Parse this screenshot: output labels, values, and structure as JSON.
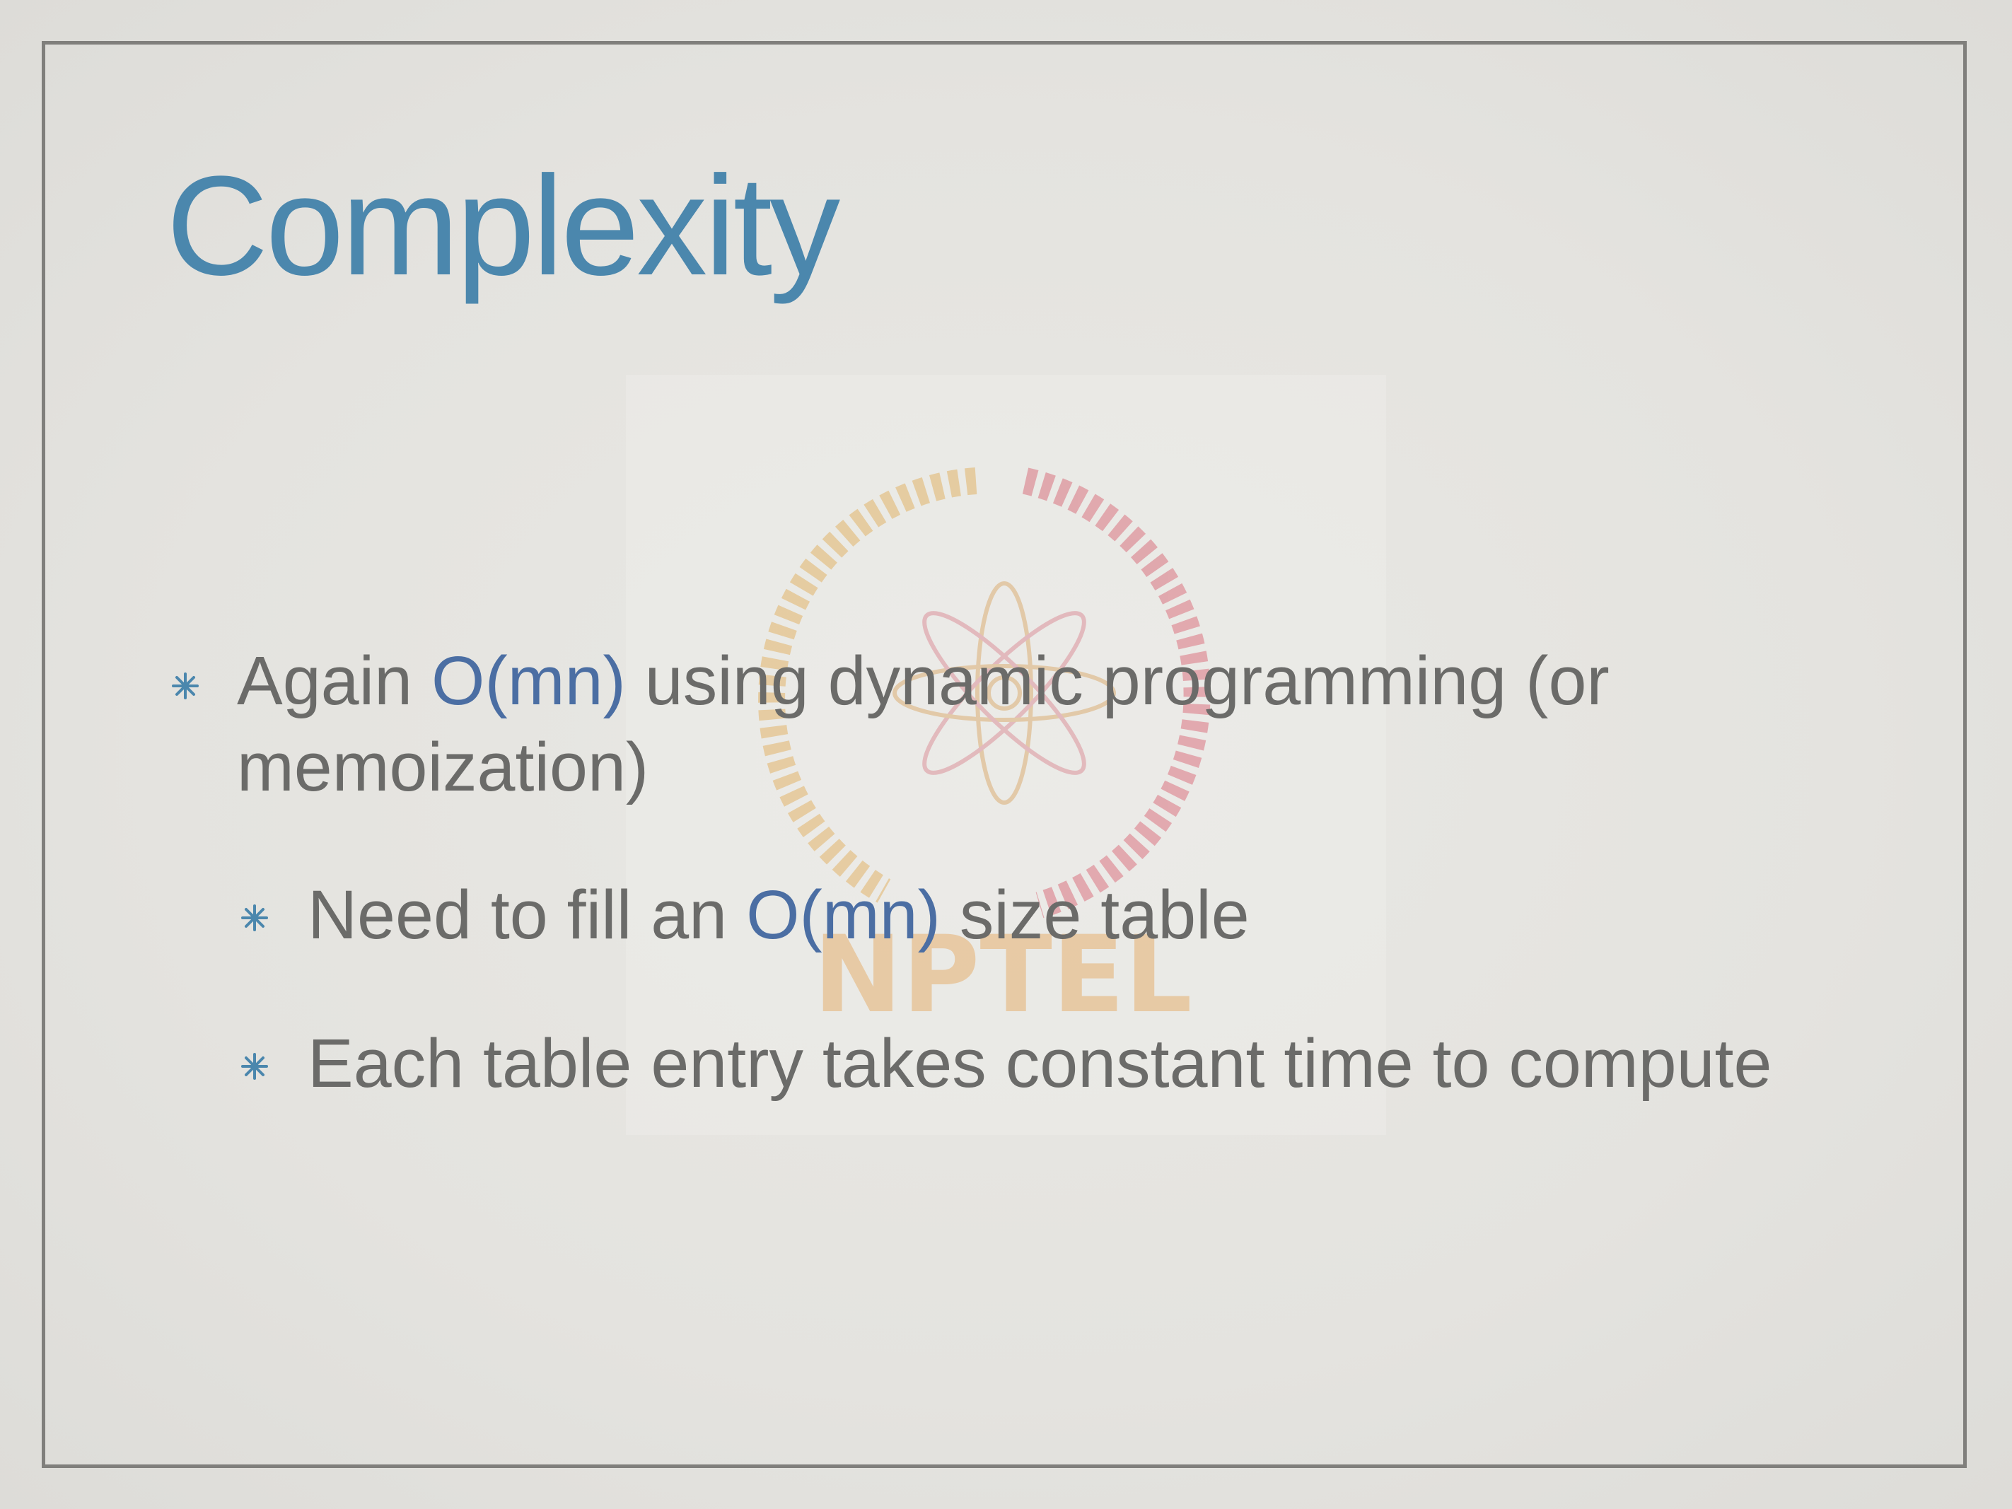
{
  "slide": {
    "title": "Complexity",
    "watermark_text": "NPTEL",
    "bullets": [
      {
        "level": 1,
        "line1_pre": "Again ",
        "line1_highlight": "O(mn)",
        "line1_post": " using dynamic programming (or",
        "line2": "memoization)"
      },
      {
        "level": 2,
        "pre": "Need to fill an ",
        "highlight": "O(mn)",
        "post": " size table"
      },
      {
        "level": 2,
        "text": "Each table entry takes constant time to compute"
      }
    ]
  },
  "colors": {
    "title": "#4b87ad",
    "body_text": "#6b6b69",
    "highlight": "#4b6ea3",
    "bullet_marker": "#4b87ad",
    "frame": "#807f7c",
    "background": "#e6e5e1"
  },
  "icons": {
    "bullet_marker": "asterisk-bullet-icon",
    "watermark": "nptel-logo"
  }
}
